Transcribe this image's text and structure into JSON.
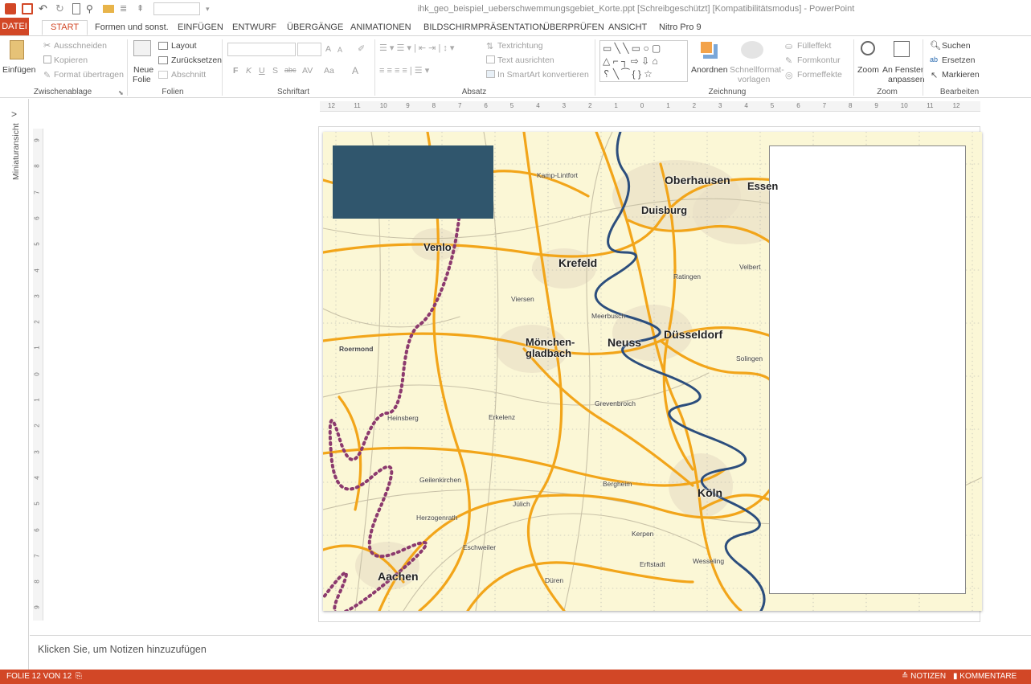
{
  "window": {
    "title": "ihk_geo_beispiel_ueberschwemmungsgebiet_Korte.ppt [Schreibgeschützt] [Kompatibilitätsmodus] - PowerPoint"
  },
  "tabs": [
    {
      "label": "DATEI"
    },
    {
      "label": "START"
    },
    {
      "label": "Formen und sonst."
    },
    {
      "label": "EINFÜGEN"
    },
    {
      "label": "ENTWURF"
    },
    {
      "label": "ÜBERGÄNGE"
    },
    {
      "label": "ANIMATIONEN"
    },
    {
      "label": "BILDSCHIRMPRÄSENTATION"
    },
    {
      "label": "ÜBERPRÜFEN"
    },
    {
      "label": "ANSICHT"
    },
    {
      "label": "Nitro Pro 9"
    }
  ],
  "ribbon": {
    "clipboard": {
      "paste": "Einfügen",
      "cut": "Ausschneiden",
      "copy": "Kopieren",
      "format_painter": "Format übertragen",
      "group": "Zwischenablage"
    },
    "slides": {
      "new_slide_1": "Neue",
      "new_slide_2": "Folie",
      "layout": "Layout",
      "reset": "Zurücksetzen",
      "section": "Abschnitt",
      "group": "Folien"
    },
    "font": {
      "bold": "F",
      "italic": "K",
      "underline": "U",
      "shadow": "S",
      "strike": "abc",
      "spacing": "AV",
      "case": "Aa",
      "grow": "A",
      "shrink": "A",
      "color": "A",
      "group": "Schriftart"
    },
    "paragraph": {
      "text_direction": "Textrichtung",
      "align_text": "Text ausrichten",
      "smartart": "In SmartArt konvertieren",
      "group": "Absatz"
    },
    "drawing": {
      "arrange": "Anordnen",
      "quick_styles_1": "Schnellformat-",
      "quick_styles_2": "vorlagen",
      "fill": "Fülleffekt",
      "outline": "Formkontur",
      "effects": "Formeffekte",
      "group": "Zeichnung"
    },
    "zoom": {
      "zoom": "Zoom",
      "fit_1": "An Fenster",
      "fit_2": "anpassen",
      "group": "Zoom"
    },
    "editing": {
      "find": "Suchen",
      "replace": "Ersetzen",
      "select": "Markieren",
      "group": "Bearbeiten"
    }
  },
  "thumbnail_pane": {
    "label": "Miniaturansicht",
    "expand": ">"
  },
  "ruler": {
    "horizontal": [
      "12",
      "11",
      "10",
      "9",
      "8",
      "7",
      "6",
      "5",
      "4",
      "3",
      "2",
      "1",
      "0",
      "1",
      "2",
      "3",
      "4",
      "5",
      "6",
      "7",
      "8",
      "9",
      "10",
      "11",
      "12"
    ],
    "vertical": [
      "9",
      "8",
      "7",
      "6",
      "5",
      "4",
      "3",
      "2",
      "1",
      "0",
      "1",
      "2",
      "3",
      "4",
      "5",
      "6",
      "7",
      "8",
      "9"
    ]
  },
  "map": {
    "cities": [
      {
        "name": "Oberhausen"
      },
      {
        "name": "Essen"
      },
      {
        "name": "Duisburg"
      },
      {
        "name": "Venlo"
      },
      {
        "name": "Krefeld"
      },
      {
        "name": "Düsseldorf"
      },
      {
        "name": "Mönchen-"
      },
      {
        "name": "gladbach"
      },
      {
        "name": "Neuss"
      },
      {
        "name": "Köln"
      },
      {
        "name": "Aachen"
      }
    ],
    "towns": [
      {
        "name": "Kamp-Lintfort"
      },
      {
        "name": "Velbert"
      },
      {
        "name": "Ratingen"
      },
      {
        "name": "Viersen"
      },
      {
        "name": "Meerbusch"
      },
      {
        "name": "Roermond"
      },
      {
        "name": "Solingen"
      },
      {
        "name": "Grevenbroich"
      },
      {
        "name": "Heinsberg"
      },
      {
        "name": "Erkelenz"
      },
      {
        "name": "Geilenkirchen"
      },
      {
        "name": "Bergheim"
      },
      {
        "name": "Jülich"
      },
      {
        "name": "Herzogenrath"
      },
      {
        "name": "Kerpen"
      },
      {
        "name": "Eschweiler"
      },
      {
        "name": "Erftstadt"
      },
      {
        "name": "Wesseling"
      },
      {
        "name": "Düren"
      }
    ],
    "colors": {
      "background": "#fbf7d6",
      "roads": "#f2a51a",
      "river": "#2c4e7d",
      "border": "#8c3a6e",
      "titlebox": "#30566d"
    }
  },
  "notes": {
    "placeholder": "Klicken Sie, um Notizen hinzuzufügen"
  },
  "status": {
    "slide": "FOLIE 12 VON 12",
    "notes": "NOTIZEN",
    "comments": "KOMMENTARE",
    "accent": "#d24726"
  }
}
